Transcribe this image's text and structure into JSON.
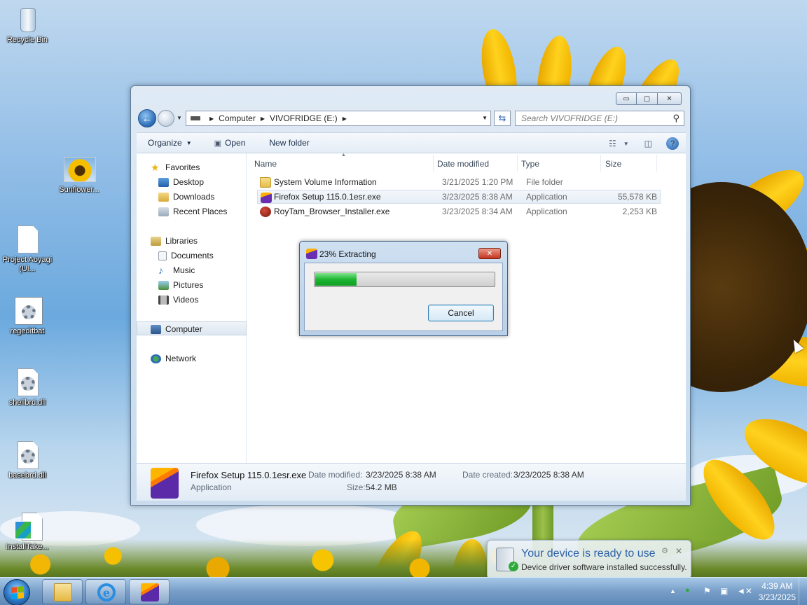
{
  "desktop": {
    "icons": [
      {
        "label": "Recycle Bin",
        "icon": "recycle-bin-icon"
      },
      {
        "label": "Sunflower...",
        "icon": "image-icon"
      },
      {
        "label": "Project Aoyagi (Ul...",
        "icon": "document-icon"
      },
      {
        "label": "regeditbat",
        "icon": "batch-file-icon"
      },
      {
        "label": "shellbrd.dll",
        "icon": "dll-file-icon"
      },
      {
        "label": "basebrd.dll",
        "icon": "dll-file-icon"
      },
      {
        "label": "InstallTake...",
        "icon": "registry-file-icon"
      }
    ]
  },
  "explorer": {
    "caption_buttons": {
      "minimize": "▭",
      "maximize": "▢",
      "close": "✕"
    },
    "address": {
      "root": "Computer",
      "drive": "VIVOFRIDGE (E:)"
    },
    "search_placeholder": "Search VIVOFRIDGE (E:)",
    "toolbar": {
      "organize": "Organize",
      "open": "Open",
      "new_folder": "New folder"
    },
    "nav": {
      "favorites": "Favorites",
      "favorites_items": [
        "Desktop",
        "Downloads",
        "Recent Places"
      ],
      "libraries": "Libraries",
      "libraries_items": [
        "Documents",
        "Music",
        "Pictures",
        "Videos"
      ],
      "computer": "Computer",
      "network": "Network"
    },
    "columns": {
      "name": "Name",
      "date": "Date modified",
      "type": "Type",
      "size": "Size"
    },
    "files": [
      {
        "name": "System Volume Information",
        "date": "3/21/2025 1:20 PM",
        "type": "File folder",
        "size": "",
        "icon": "folder-icon"
      },
      {
        "name": "Firefox Setup 115.0.1esr.exe",
        "date": "3/23/2025 8:38 AM",
        "type": "Application",
        "size": "55,578 KB",
        "icon": "firefox-installer-icon"
      },
      {
        "name": "RoyTam_Browser_Installer.exe",
        "date": "3/23/2025 8:34 AM",
        "type": "Application",
        "size": "2,253 KB",
        "icon": "roytam-installer-icon"
      }
    ],
    "details": {
      "name": "Firefox Setup 115.0.1esr.exe",
      "type": "Application",
      "date_modified_label": "Date modified:",
      "date_modified": "3/23/2025 8:38 AM",
      "size_label": "Size:",
      "size": "54.2 MB",
      "date_created_label": "Date created:",
      "date_created": "3/23/2025 8:38 AM"
    }
  },
  "dialog": {
    "title": "23% Extracting",
    "progress": 0.23,
    "close": "✕",
    "cancel": "Cancel"
  },
  "balloon": {
    "title": "Your device is ready to use",
    "text": "Device driver software installed successfully.",
    "close": "✕"
  },
  "taskbar": {
    "time": "4:39 AM",
    "date": "3/23/2025",
    "tray_up": "▲"
  }
}
